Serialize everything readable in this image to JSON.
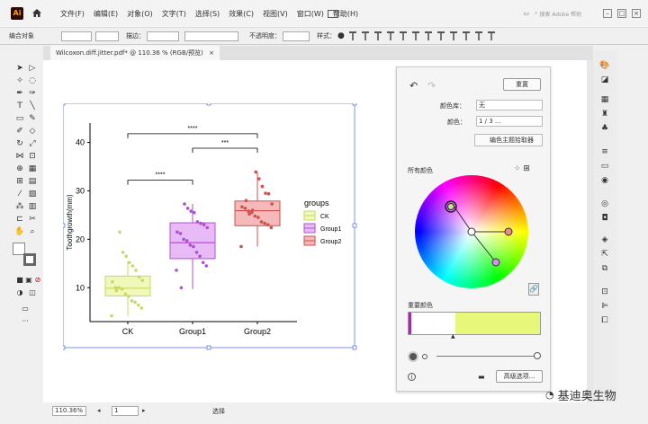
{
  "menubar": {
    "items": [
      "文件(F)",
      "编辑(E)",
      "对象(O)",
      "文字(T)",
      "选择(S)",
      "效果(C)",
      "视图(V)",
      "窗口(W)",
      "帮助(H)"
    ],
    "search_placeholder": "搜索 Adobe 帮助"
  },
  "control": {
    "label": "编合对象",
    "stroke_label": "描边：",
    "opacity_label": "不透明度：",
    "style_label": "样式："
  },
  "document_tab": {
    "title": "Wilcoxon.diff.jitter.pdf* @ 110.36 % (RGB/预览)",
    "close": "×"
  },
  "status": {
    "zoom": "110.36%",
    "page": "1",
    "mode": "选择"
  },
  "panel": {
    "reset": "重置",
    "library_label": "颜色库：",
    "library_value": "无",
    "color_label": "颜色：",
    "color_value": "1 / 3 ...",
    "color_group_label": "编色主题拾取器",
    "all_colors_label": "所有颜色",
    "recolor_label": "重要颜色",
    "options_button": "高级选项..."
  },
  "watermark": {
    "text": "基迪奥生物"
  },
  "chart_data": {
    "type": "box",
    "categories": [
      "CK",
      "Group1",
      "Group2"
    ],
    "ylabel": "Toothgrowth(mm)",
    "xlabel": "",
    "ylim": [
      3,
      44
    ],
    "yticks": [
      10,
      20,
      30,
      40
    ],
    "legend": {
      "title": "groups",
      "entries": [
        "CK",
        "Group1",
        "Group2"
      ],
      "placement": "right"
    },
    "colors": {
      "CK": "#e6f58a",
      "Group1": "#d88ef0",
      "Group2": "#ee8a8a"
    },
    "series": [
      {
        "name": "CK",
        "q1": 8.3,
        "median": 9.9,
        "q3": 12.4,
        "min": 4.2,
        "max": 15.5,
        "points": [
          4.2,
          5.8,
          6.4,
          7.0,
          7.3,
          8.2,
          8.7,
          9.7,
          10.0,
          10.0,
          11.2,
          11.5,
          12.2,
          13.6,
          14.5,
          15.2,
          16.5,
          17.3,
          21.5,
          9.4
        ]
      },
      {
        "name": "Group1",
        "q1": 16.0,
        "median": 19.3,
        "q3": 23.4,
        "min": 9.7,
        "max": 27.3,
        "points": [
          13.6,
          14.5,
          15.2,
          16.5,
          17.3,
          18.5,
          18.8,
          19.7,
          20.0,
          21.2,
          21.5,
          22.4,
          23.0,
          23.3,
          23.6,
          25.5,
          25.8,
          26.4,
          27.3,
          10.0
        ]
      },
      {
        "name": "Group2",
        "q1": 22.8,
        "median": 25.9,
        "q3": 27.9,
        "min": 18.5,
        "max": 33.9,
        "points": [
          18.5,
          22.4,
          23.0,
          23.3,
          23.6,
          24.5,
          24.8,
          25.5,
          25.8,
          26.4,
          26.7,
          27.3,
          29.4,
          29.5,
          30.9,
          32.5,
          33.9,
          26.0,
          25.2,
          28.0
        ]
      }
    ],
    "significance": [
      {
        "pair": "CK-Group2",
        "label": "****"
      },
      {
        "pair": "Group1-Group2",
        "label": "***"
      },
      {
        "pair": "CK-Group1",
        "label": "****"
      }
    ]
  }
}
